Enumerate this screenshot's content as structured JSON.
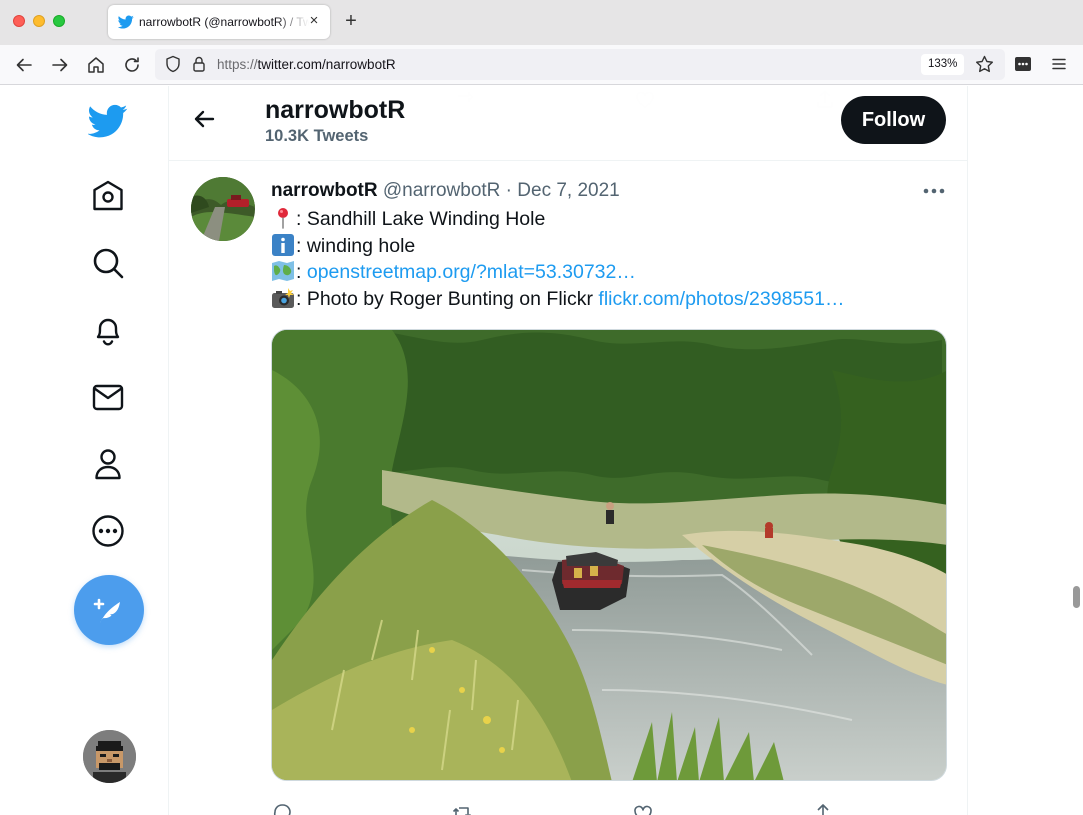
{
  "browser": {
    "tab_title": "narrowbotR (@narrowbotR) / Twitter",
    "tab_close": "×",
    "new_tab": "+",
    "url_scheme": "https://",
    "url_host_path": "twitter.com/narrowbotR",
    "zoom": "133%"
  },
  "sidebar": {
    "items": [
      {
        "icon": "twitter-logo-icon"
      },
      {
        "icon": "home-icon"
      },
      {
        "icon": "search-icon"
      },
      {
        "icon": "bell-icon"
      },
      {
        "icon": "mail-icon"
      },
      {
        "icon": "profile-icon"
      },
      {
        "icon": "more-circle-icon"
      }
    ],
    "compose_icon": "compose-tweet-icon"
  },
  "header": {
    "name": "narrowbotR",
    "tweet_count": "10.3K Tweets",
    "follow_label": "Follow"
  },
  "tweet": {
    "author_name": "narrowbotR",
    "handle": "@narrowbotR",
    "separator": "·",
    "date": "Dec 7, 2021",
    "lines": [
      {
        "emoji": "round-pushpin-emoji",
        "text": ": Sandhill Lake Winding Hole",
        "link": ""
      },
      {
        "emoji": "information-emoji",
        "text": ": winding hole",
        "link": ""
      },
      {
        "emoji": "world-map-emoji",
        "text": ": ",
        "link": "openstreetmap.org/?mlat=53.30732…"
      },
      {
        "emoji": "camera-flash-emoji",
        "text": ": Photo by Roger Bunting on Flickr ",
        "link": "flickr.com/photos/2398551…"
      }
    ]
  },
  "colors": {
    "twitter_blue": "#1d9bf0",
    "compose_blue": "#4c9ded",
    "follow_bg": "#0f1419",
    "secondary_text": "#536471"
  }
}
